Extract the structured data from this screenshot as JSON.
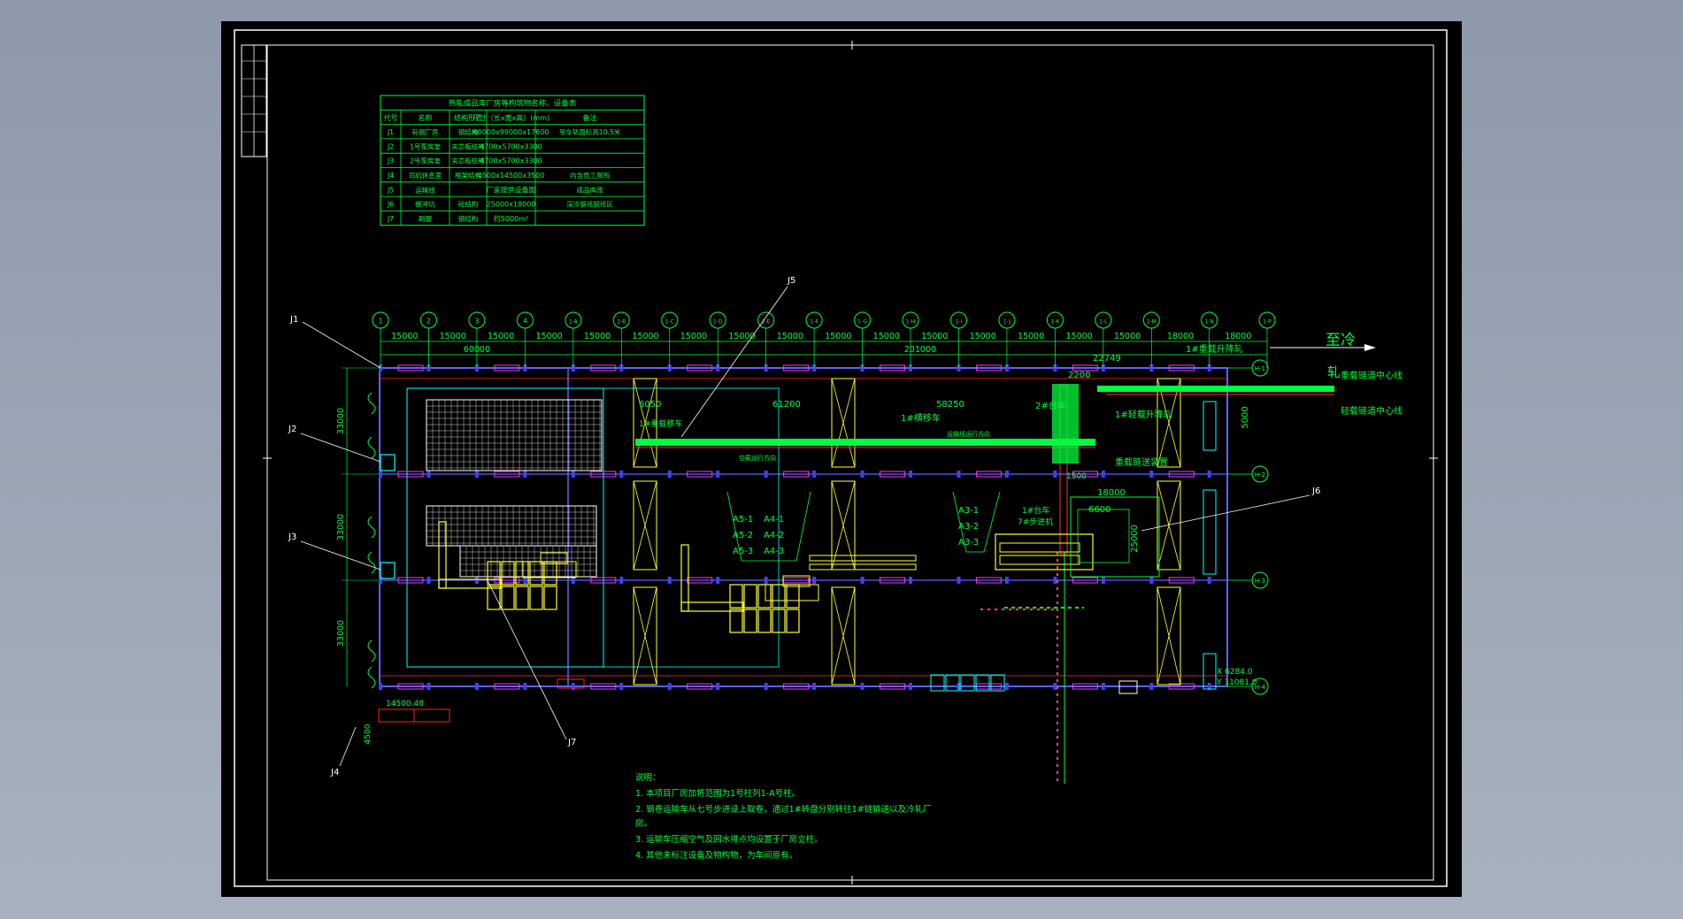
{
  "table": {
    "title": "热轧成品库厂房等构筑物名称、设备表",
    "headers": [
      "代号",
      "名称",
      "结构形式",
      "尺寸（长x宽x高）(mm)",
      "备注"
    ],
    "rows": [
      [
        "J1",
        "轧钢厂房",
        "钢结构",
        "60000x99000x17600",
        "吊车轨面标高10.5米"
      ],
      [
        "J2",
        "1号泵房室",
        "夹芯板结构",
        "4700x5700x3300",
        ""
      ],
      [
        "J3",
        "2号泵房室",
        "夹芯板结构",
        "4700x5700x3300",
        ""
      ],
      [
        "J4",
        "司机休息室",
        "框架结构",
        "4500x14500x3500",
        "内含员工厕所"
      ],
      [
        "J5",
        "运输线",
        "",
        "厂家提供设备图",
        "成品库改"
      ],
      [
        "J6",
        "缓冲坑",
        "砼结构",
        "25000x18000",
        "深冷钢坯钢坯区"
      ],
      [
        "J7",
        "刷屋",
        "钢结构",
        "约5000m³",
        ""
      ]
    ]
  },
  "axes_top": {
    "labels": [
      "1",
      "2",
      "3",
      "4",
      "1-A",
      "1-B",
      "1-C",
      "1-D",
      "1-E",
      "1-F",
      "1-G",
      "1-H",
      "1-I",
      "1-J",
      "1-K",
      "1-L",
      "1-M",
      "1-N",
      "1-P"
    ],
    "spacings": [
      "15000",
      "15000",
      "15000",
      "15000",
      "15000",
      "15000",
      "15000",
      "15000",
      "15000",
      "15000",
      "15000",
      "15000",
      "15000",
      "15000",
      "15000",
      "15000",
      "18000",
      "18000"
    ],
    "total_a": "60000",
    "total_b": "201000"
  },
  "axes_right": {
    "labels": [
      "H-1",
      "H-2",
      "H-3",
      "H-4"
    ]
  },
  "left_dims": [
    "33000",
    "33000",
    "33000"
  ],
  "callouts": {
    "j1": "J1",
    "j2": "J2",
    "j3": "J3",
    "j4": "J4",
    "j5": "J5",
    "j6": "J6",
    "j7": "J7"
  },
  "labels": {
    "to_cold": "至冷",
    "to_cold_2": "轧",
    "center_line_1": "重载链道中心线",
    "center_line_2": "轻载链道中心线",
    "lift_1": "1#重载升降轧",
    "lift_2": "1#轻载升降轧",
    "chain": "重载链送装置",
    "transfer_1": "1#重载移车",
    "transfer_2": "1#横移车",
    "trolley": "2#台车",
    "trolley_2": "1#台车",
    "car": "7#步进机",
    "dim_22749": "22749",
    "dim_6050": "6050",
    "dim_61200": "61200",
    "dim_58250": "58250",
    "dim_2200": "2200",
    "dim_18000": "18000",
    "dim_6600": "6600",
    "dim_25000": "25000",
    "dim_5000": "5000",
    "dim_1500": "1500",
    "dim_14500": "14500.48",
    "dim_4500": "4500",
    "coord_x": "X 6284.0",
    "coord_y": "Y 11081.0",
    "a_groups": [
      "A5-1",
      "A5-2",
      "A5-3",
      "A4-1",
      "A4-2",
      "A4-3",
      "A3-1",
      "A3-2",
      "A3-3"
    ],
    "direction_1": "运输线运行方向",
    "direction_2": "空载运行方向"
  },
  "notes": {
    "title": "说明：",
    "lines": [
      "1. 本项目厂房加将范围为1号柱列1-A号柱。",
      "2. 钢卷运输车从七号步进设上取卷，通过1#转盘分别转往1#链输送以及冷轧厂",
      "房。",
      "3. 运输车压缩空气及回水排点均设置于厂房立柱。",
      "4. 其他未标注设备及物构物，为车间原有。"
    ]
  },
  "colors": {
    "green": "#00ff3c",
    "cyan": "#00ffff",
    "yellow": "#ffff33",
    "magenta": "#ff33ff",
    "blue": "#4040ff",
    "red": "#ff2020",
    "white": "#ffffff"
  }
}
